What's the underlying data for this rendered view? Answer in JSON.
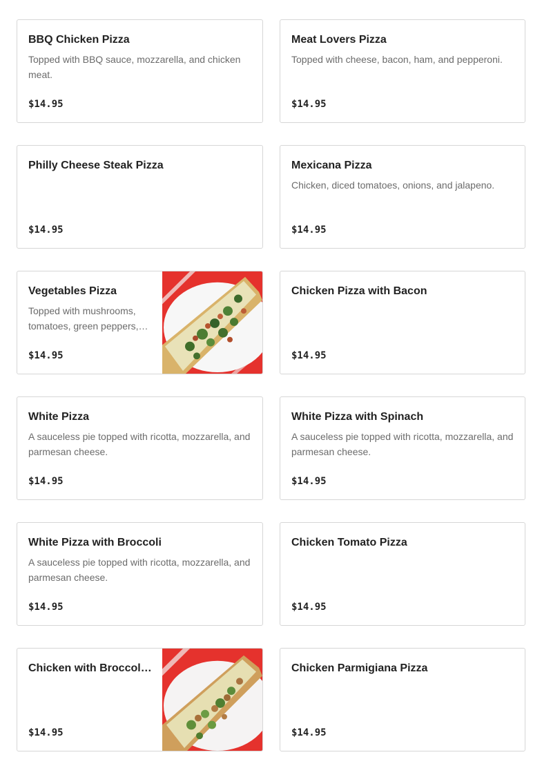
{
  "menu": {
    "items": [
      {
        "name": "BBQ Chicken Pizza",
        "description": "Topped with BBQ sauce, mozzarella, and chicken meat.",
        "price": "$14.95",
        "image": ""
      },
      {
        "name": "Meat Lovers Pizza",
        "description": "Topped with cheese, bacon, ham, and pepperoni.",
        "price": "$14.95",
        "image": ""
      },
      {
        "name": "Philly Cheese Steak Pizza",
        "description": "",
        "price": "$14.95",
        "image": ""
      },
      {
        "name": "Mexicana Pizza",
        "description": "Chicken, diced tomatoes, onions, and jalapeno.",
        "price": "$14.95",
        "image": ""
      },
      {
        "name": "Vegetables Pizza",
        "description": "Topped with mushrooms, tomatoes, green peppers, onions, olives, and broccoli.",
        "price": "$14.95",
        "image": "vegetable-pizza-slice-photo"
      },
      {
        "name": "Chicken Pizza with Bacon",
        "description": "",
        "price": "$14.95",
        "image": ""
      },
      {
        "name": "White Pizza",
        "description": "A sauceless pie topped with ricotta, mozzarella, and parmesan cheese.",
        "price": "$14.95",
        "image": ""
      },
      {
        "name": "White Pizza with Spinach",
        "description": "A sauceless pie topped with ricotta, mozzarella, and parmesan cheese.",
        "price": "$14.95",
        "image": ""
      },
      {
        "name": "White Pizza with Broccoli",
        "description": "A sauceless pie topped with ricotta, mozzarella, and parmesan cheese.",
        "price": "$14.95",
        "image": ""
      },
      {
        "name": "Chicken Tomato Pizza",
        "description": "",
        "price": "$14.95",
        "image": ""
      },
      {
        "name": "Chicken with Broccoli Pizza",
        "description": "",
        "price": "$14.95",
        "image": "chicken-broccoli-pizza-slice-photo"
      },
      {
        "name": "Chicken Parmigiana Pizza",
        "description": "",
        "price": "$14.95",
        "image": ""
      }
    ]
  },
  "colors": {
    "border": "#d6d6d6",
    "title": "#222222",
    "description": "#6b6b6b",
    "tray_red": "#e5322d"
  }
}
